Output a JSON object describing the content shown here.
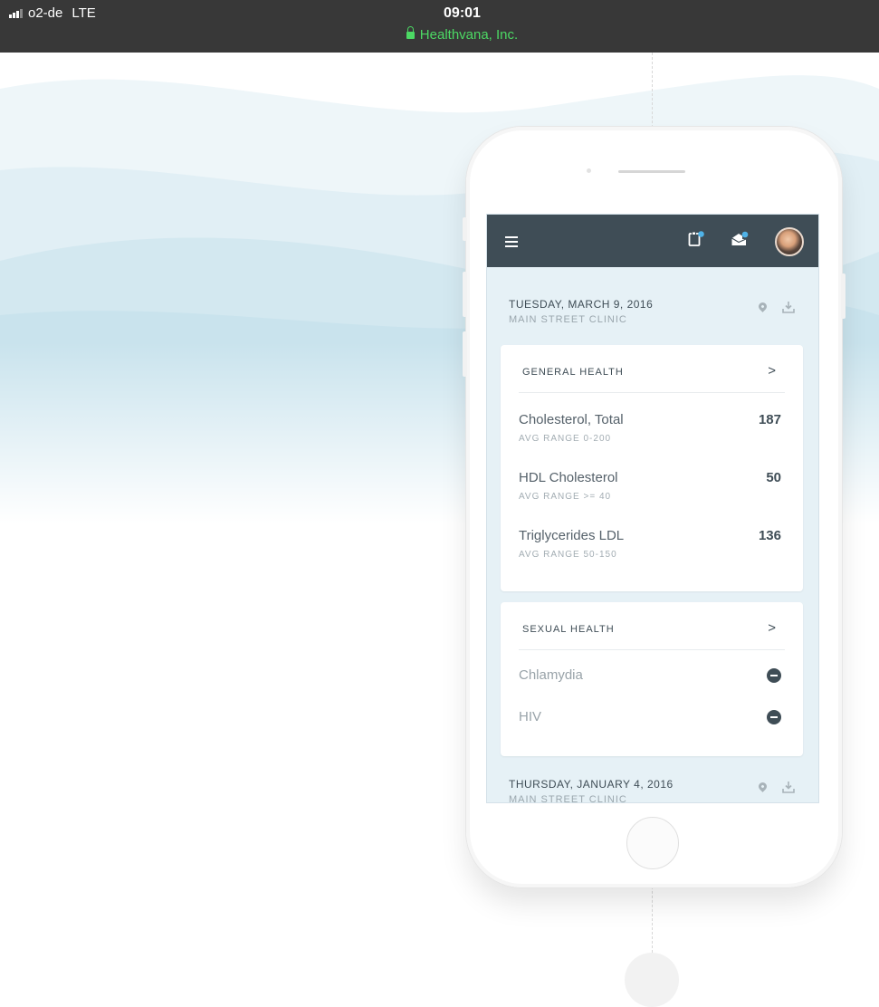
{
  "status_bar": {
    "carrier": "o2-de",
    "network": "LTE",
    "time": "09:01",
    "site": "Healthvana, Inc."
  },
  "colors": {
    "header_bg": "#3f4d56",
    "screen_bg": "#e6f1f6",
    "notification_dot": "#4fb3e8",
    "secure_green": "#4cd964"
  },
  "app": {
    "header_icons": [
      "menu-icon",
      "documents-icon",
      "mail-icon",
      "avatar"
    ],
    "visits": [
      {
        "date": "TUESDAY, MARCH 9, 2016",
        "location": "MAIN STREET CLINIC"
      },
      {
        "date": "THURSDAY, JANUARY 4, 2016",
        "location": "MAIN STREET CLINIC"
      }
    ],
    "general_health": {
      "title": "GENERAL HEALTH",
      "results": [
        {
          "name": "Cholesterol, Total",
          "range": "AVG RANGE 0-200",
          "value": "187"
        },
        {
          "name": "HDL Cholesterol",
          "range": "AVG RANGE >= 40",
          "value": "50"
        },
        {
          "name": "Triglycerides LDL",
          "range": "AVG RANGE 50-150",
          "value": "136"
        }
      ]
    },
    "sexual_health": {
      "title": "SEXUAL HEALTH",
      "results": [
        {
          "name": "Chlamydia",
          "status_icon": "minus-circle-icon"
        },
        {
          "name": "HIV",
          "status_icon": "minus-circle-icon"
        }
      ]
    }
  }
}
